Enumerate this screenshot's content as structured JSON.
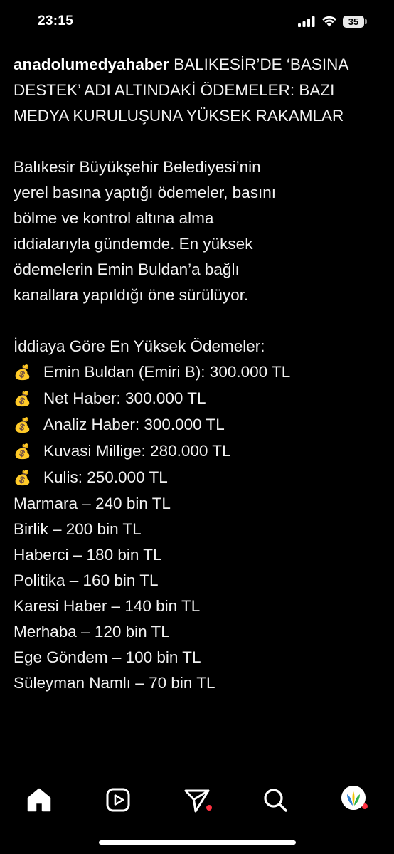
{
  "status_bar": {
    "time": "23:15",
    "battery_level": "35",
    "icons": [
      "signal-icon",
      "wifi-icon",
      "battery-icon"
    ]
  },
  "post": {
    "username": "anadolumedyahaber",
    "headline": "BALIKESİR’DE ‘BASINA DESTEK’ ADI ALTINDAKİ ÖDEMELER: BAZI MEDYA KURULUŞUNA YÜKSEK RAKAMLAR",
    "body_lines": [
      "Balıkesir Büyükşehir Belediyesi’nin",
      "yerel basına yaptığı ödemeler, basını",
      "bölme ve kontrol altına alma",
      "iddialarıyla gündemde. En yüksek",
      "ödemelerin Emin Buldan’a bağlı",
      "kanallara yapıldığı öne sürülüyor."
    ],
    "list_title": "İddiaya Göre En Yüksek Ödemeler:",
    "bag_emoji": "💰",
    "top_payments": [
      "Emin Buldan (Emiri B): 300.000 TL",
      "Net Haber: 300.000 TL",
      "Analiz Haber: 300.000 TL",
      "Kuvasi Millige: 280.000 TL",
      "Kulis: 250.000 TL"
    ],
    "other_payments": [
      "Marmara – 240 bin TL",
      "Birlik – 200 bin TL",
      "Haberci – 180 bin TL",
      "Politika – 160 bin TL",
      "Karesi Haber – 140 bin TL",
      "Merhaba – 120 bin TL",
      "Ege Göndem – 100 bin TL",
      "Süleyman Namlı – 70 bin TL"
    ]
  },
  "bottom_nav": {
    "items": [
      "home-icon",
      "reels-icon",
      "send-icon",
      "search-icon",
      "profile-avatar"
    ],
    "notification_color": "#ff3040"
  },
  "colors": {
    "background": "#000000",
    "text": "#f2f2f2"
  }
}
